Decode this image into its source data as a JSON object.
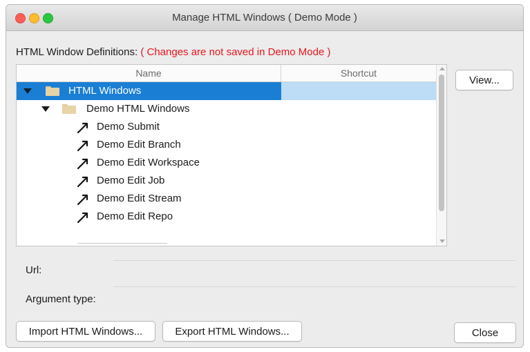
{
  "window": {
    "title": "Manage HTML Windows ( Demo Mode )"
  },
  "definitions": {
    "label": "HTML Window Definitions:",
    "warning": "( Changes are not saved in Demo Mode )"
  },
  "tree": {
    "columns": {
      "name": "Name",
      "shortcut": "Shortcut"
    },
    "rows": [
      {
        "label": "HTML Windows",
        "shortcut": ""
      },
      {
        "label": "Demo HTML Windows",
        "shortcut": ""
      },
      {
        "label": "Demo Submit",
        "shortcut": ""
      },
      {
        "label": "Demo Edit Branch",
        "shortcut": ""
      },
      {
        "label": "Demo Edit Workspace",
        "shortcut": ""
      },
      {
        "label": "Demo Edit Job",
        "shortcut": ""
      },
      {
        "label": "Demo Edit Stream",
        "shortcut": ""
      },
      {
        "label": "Demo Edit Repo",
        "shortcut": ""
      }
    ]
  },
  "fields": {
    "url_label": "Url:",
    "url_value": "",
    "argument_type_label": "Argument type:",
    "argument_type_value": ""
  },
  "buttons": {
    "view": "View...",
    "import": "Import HTML Windows...",
    "export": "Export HTML Windows...",
    "close": "Close"
  },
  "colors": {
    "selection": "#1a7fd4",
    "selection_shortcut": "#bddcf6",
    "warning": "#e8151c",
    "folder": "#e7d3a7"
  },
  "icons": {
    "folder": "folder-icon",
    "window_item": "hammer-icon",
    "disclosure": "disclosure-triangle-icon"
  }
}
